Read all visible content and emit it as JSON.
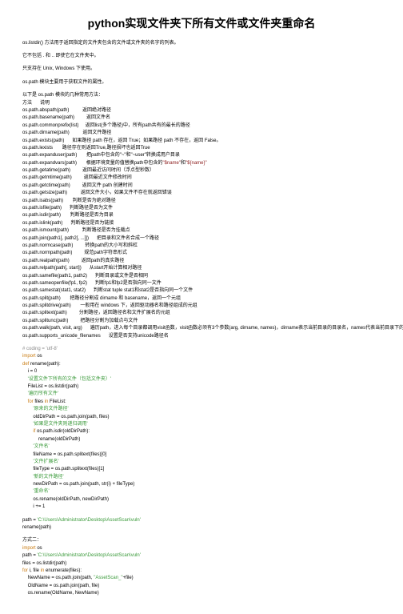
{
  "title": "python实现文件夹下所有文件或文件夹重命名",
  "intro1": "os.listdir() 方法用于返回指定的文件夹包含的文件或文件夹的名字的列表。",
  "intro2": "它不包括 . 和 .. 即使它在文件夹中。",
  "intro3": "只支持在 Unix, Windows 下使用。",
  "intro4": "os.path 模块主要用于获取文件的属性。",
  "api_header": "以下是 os.path 模块的几种常用方法：",
  "api_header2": "方法      说明",
  "api": [
    "os.path.abspath(path)          返回绝对路径",
    "os.path.basename(path)         返回文件名",
    "os.path.commonprefix(list)     返回list(多个路径)中，所有path共有的最长的路径",
    "os.path.dirname(path)          返回文件路径",
    "os.path.exists(path)      如果路径 path 存在，返回 True；如果路径 path 不存在，返回 False。",
    "os.path.lexists       路径存在则返回True,路径损坏也返回True",
    "os.path.expanduser(path)       把path中包含的\"~\"和\"~user\"转换成用户目录",
    "os.path.expandvars(path)       根据环境变量的值替换path中包含的\"$name\"和\"${name}\"",
    "os.path.getatime(path)         返回最近访问时间（浮点型秒数）",
    "os.path.getmtime(path)         返回最近文件修改时间",
    "os.path.getctime(path)         返回文件 path 创建时间",
    "os.path.getsize(path)          返回文件大小，如果文件不存在就返回错误",
    "os.path.isabs(path)       判断是否为绝对路径",
    "os.path.isfile(path)      判断路径是否为文件",
    "os.path.isdir(path)       判断路径是否为目录",
    "os.path.islink(path)      判断路径是否为链接",
    "os.path.ismount(path)          判断路径是否为挂载点",
    "os.path.join(path1[, path2[, ...]])      把目录和文件名合成一个路径",
    "os.path.normcase(path)         转换path的大小写和斜杠",
    "os.path.normpath(path)         规范path字符串形式",
    "os.path.realpath(path)         返回path的真实路径",
    "os.path.relpath(path[, start])      从start开始计算相对路径",
    "os.path.samefile(path1, path2)      判断目录或文件是否相同",
    "os.path.sameopenfile(fp1, fp2)      判断fp1和fp2是否指向同一文件",
    "os.path.samestat(stat1, stat2)      判断stat tuple stat1和stat2是否指向同一个文件",
    "os.path.split(path)       把路径分割成 dirname 和 basename，返回一个元组",
    "os.path.splitdrive(path)       一般用在 windows 下，返回驱动器名和路径组成的元组",
    "os.path.splitext(path)         分割路径，返回路径名和文件扩展名的元组",
    "os.path.splitunc(path)         把路径分割为加载点与文件",
    "os.path.walk(path, visit, arg)      遍历path，进入每个目录都调用visit函数，visit函数必须有3个参数(arg, dirname, names)，dirname表示当前目录的目录名，names代表当前目录下的所有文件名，args则为walk的第三个参数",
    "os.path.supports_unicode_filenames      设置是否支持unicode路径名"
  ],
  "code1": [
    {
      "t": "# coding = 'utf-8'",
      "c": "comment"
    },
    {
      "t": "import os",
      "c": "kw-line",
      "kw": "import"
    },
    {
      "t": "",
      "c": ""
    },
    {
      "t": "def rename(path):",
      "c": "kw-line",
      "kw": "def"
    },
    {
      "t": "    i = 0",
      "c": ""
    },
    {
      "t": "    '设置文件下所有的文件（包括文件夹）'",
      "c": "str"
    },
    {
      "t": "    FileList = os.listdir(path)",
      "c": ""
    },
    {
      "t": "    '遍历所有文件'",
      "c": "str"
    },
    {
      "t": "    for files in FileList:",
      "c": "kw-line",
      "kw": "for"
    },
    {
      "t": "        '原来的文件路径'",
      "c": "str"
    },
    {
      "t": "        oldDirPath = os.path.join(path, files)",
      "c": ""
    },
    {
      "t": "        '如果是文件夹则递归调用'",
      "c": "str"
    },
    {
      "t": "        if os.path.isdir(oldDirPath):",
      "c": "kw-line",
      "kw": "if"
    },
    {
      "t": "            rename(oldDirPath)",
      "c": ""
    },
    {
      "t": "        '文件名'",
      "c": "str"
    },
    {
      "t": "        fileName = os.path.splitext(files)[0]",
      "c": ""
    },
    {
      "t": "        '文件扩展名'",
      "c": "str"
    },
    {
      "t": "        fileType = os.path.splitext(files)[1]",
      "c": ""
    },
    {
      "t": "        '新的文件路径'",
      "c": "str"
    },
    {
      "t": "        newDirPath = os.path.join(path, str(i) + fileType)",
      "c": ""
    },
    {
      "t": "        '重命名'",
      "c": "str"
    },
    {
      "t": "        os.rename(oldDirPath, newDirPath)",
      "c": ""
    },
    {
      "t": "        i += 1",
      "c": ""
    }
  ],
  "path_line": "path = 'C:\\Users\\Administrator\\Desktop\\AssetScan\\vuln'",
  "rename_call": "rename(path)",
  "way2": "方式二：",
  "code2": [
    {
      "t": "import os",
      "c": "kw-line",
      "kw": "import"
    },
    {
      "t": "path = 'C:\\Users\\Administrator\\Desktop\\AssetScan\\vuln'",
      "c": "path"
    },
    {
      "t": "files = os.listdir(path)",
      "c": ""
    },
    {
      "t": "for i, file in enumerate(files):",
      "c": "kw-line",
      "kw": "for"
    },
    {
      "t": "    NewName = os.path.join(path, \"AssetScan_\"+file)",
      "c": "has-str"
    },
    {
      "t": "    OldName = os.path.join(path, file)",
      "c": ""
    },
    {
      "t": "    os.rename(OldName, NewName)",
      "c": ""
    }
  ]
}
